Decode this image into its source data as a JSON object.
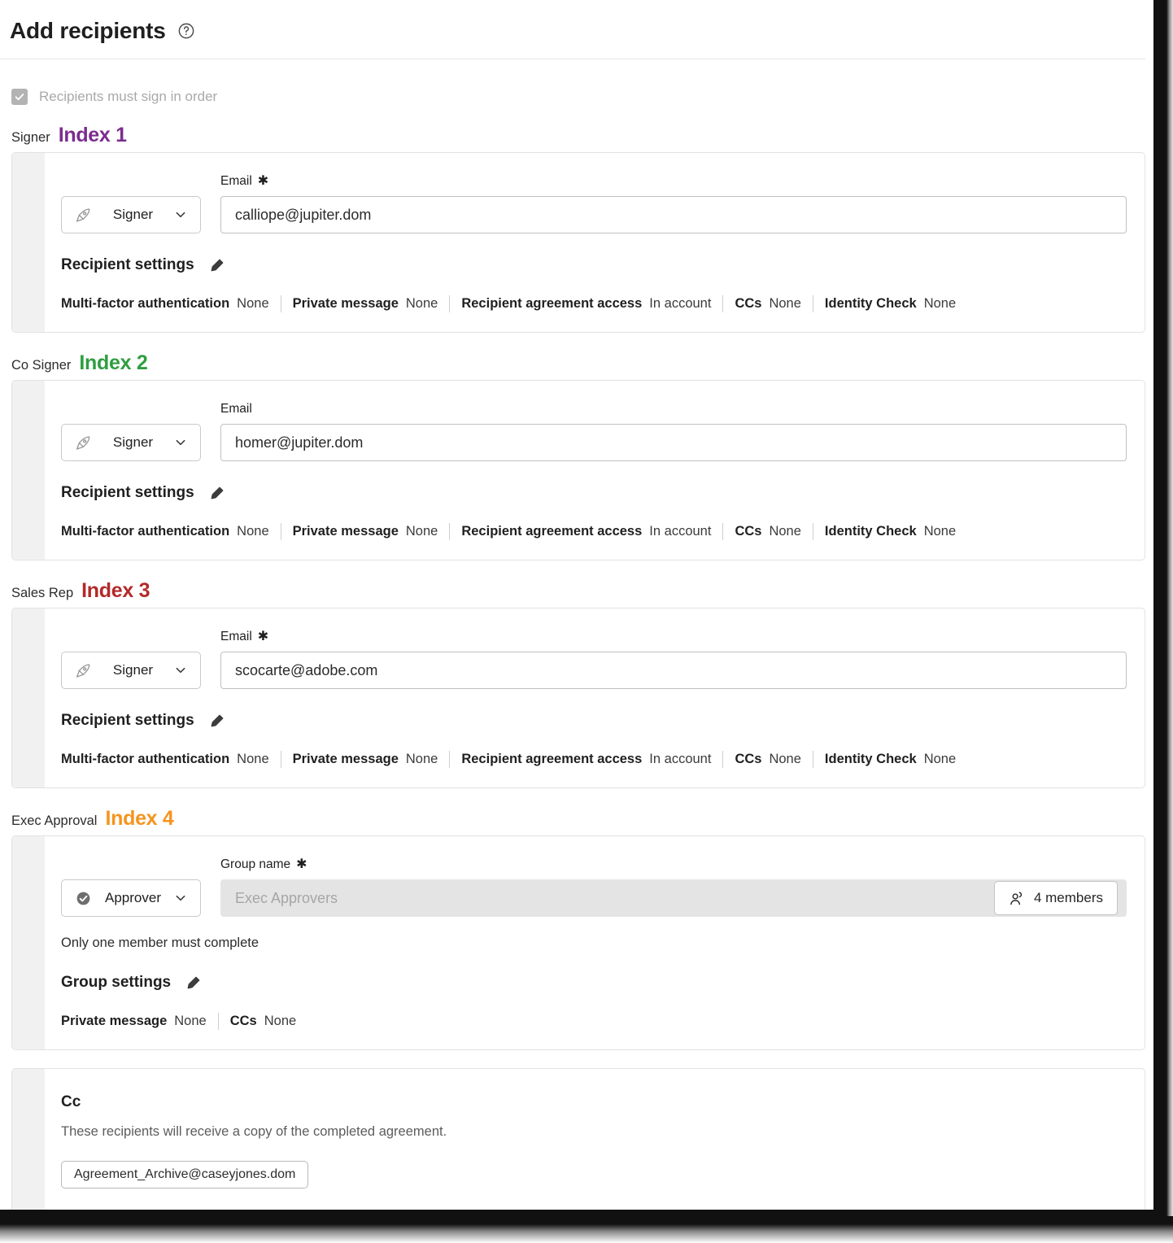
{
  "header": {
    "title": "Add recipients",
    "help_icon": "help-circle-icon"
  },
  "sign_order": {
    "label": "Recipients must sign in order",
    "checked": true,
    "disabled": true,
    "checkbox_icon": "check-icon"
  },
  "colors": {
    "index1": "#7b2d8e",
    "index2": "#2f9e41",
    "index3": "#b32a2a",
    "index4": "#f6941e",
    "card_grip": "#f1f1f1",
    "card_border": "#e2e2e2"
  },
  "recipients": [
    {
      "role_name": "Signer",
      "index_label": "Index 1",
      "index_color": "#7b2d8e",
      "role_select": {
        "icon": "pen-nib-icon",
        "label": "Signer",
        "caret": "chevron-down-icon"
      },
      "field_label": "Email",
      "required": true,
      "value": "calliope@jupiter.dom",
      "settings_title": "Recipient settings",
      "settings_edit_icon": "pencil-icon",
      "settings": [
        {
          "key": "Multi-factor authentication",
          "value": "None"
        },
        {
          "key": "Private message",
          "value": "None"
        },
        {
          "key": "Recipient agreement access",
          "value": "In account"
        },
        {
          "key": "CCs",
          "value": "None"
        },
        {
          "key": "Identity Check",
          "value": "None"
        }
      ]
    },
    {
      "role_name": "Co Signer",
      "index_label": "Index 2",
      "index_color": "#2f9e41",
      "role_select": {
        "icon": "pen-nib-icon",
        "label": "Signer",
        "caret": "chevron-down-icon"
      },
      "field_label": "Email",
      "required": false,
      "value": "homer@jupiter.dom",
      "settings_title": "Recipient settings",
      "settings_edit_icon": "pencil-icon",
      "settings": [
        {
          "key": "Multi-factor authentication",
          "value": "None"
        },
        {
          "key": "Private message",
          "value": "None"
        },
        {
          "key": "Recipient agreement access",
          "value": "In account"
        },
        {
          "key": "CCs",
          "value": "None"
        },
        {
          "key": "Identity Check",
          "value": "None"
        }
      ]
    },
    {
      "role_name": "Sales Rep",
      "index_label": "Index 3",
      "index_color": "#b32a2a",
      "role_select": {
        "icon": "pen-nib-icon",
        "label": "Signer",
        "caret": "chevron-down-icon"
      },
      "field_label": "Email",
      "required": true,
      "value": "scocarte@adobe.com",
      "settings_title": "Recipient settings",
      "settings_edit_icon": "pencil-icon",
      "settings": [
        {
          "key": "Multi-factor authentication",
          "value": "None"
        },
        {
          "key": "Private message",
          "value": "None"
        },
        {
          "key": "Recipient agreement access",
          "value": "In account"
        },
        {
          "key": "CCs",
          "value": "None"
        },
        {
          "key": "Identity Check",
          "value": "None"
        }
      ]
    }
  ],
  "group_recipient": {
    "role_name": "Exec Approval",
    "index_label": "Index 4",
    "index_color": "#f6941e",
    "role_select": {
      "icon": "approver-check-icon",
      "label": "Approver",
      "caret": "chevron-down-icon"
    },
    "field_label": "Group name",
    "required": true,
    "value": "Exec Approvers",
    "field_disabled": true,
    "members_button": {
      "icon": "users-icon",
      "label": "4 members"
    },
    "note": "Only one member must complete",
    "settings_title": "Group settings",
    "settings_edit_icon": "pencil-icon",
    "settings": [
      {
        "key": "Private message",
        "value": "None"
      },
      {
        "key": "CCs",
        "value": "None"
      }
    ]
  },
  "cc": {
    "title": "Cc",
    "subtitle": "These recipients will receive a copy of the completed agreement.",
    "chips": [
      "Agreement_Archive@caseyjones.dom"
    ]
  }
}
